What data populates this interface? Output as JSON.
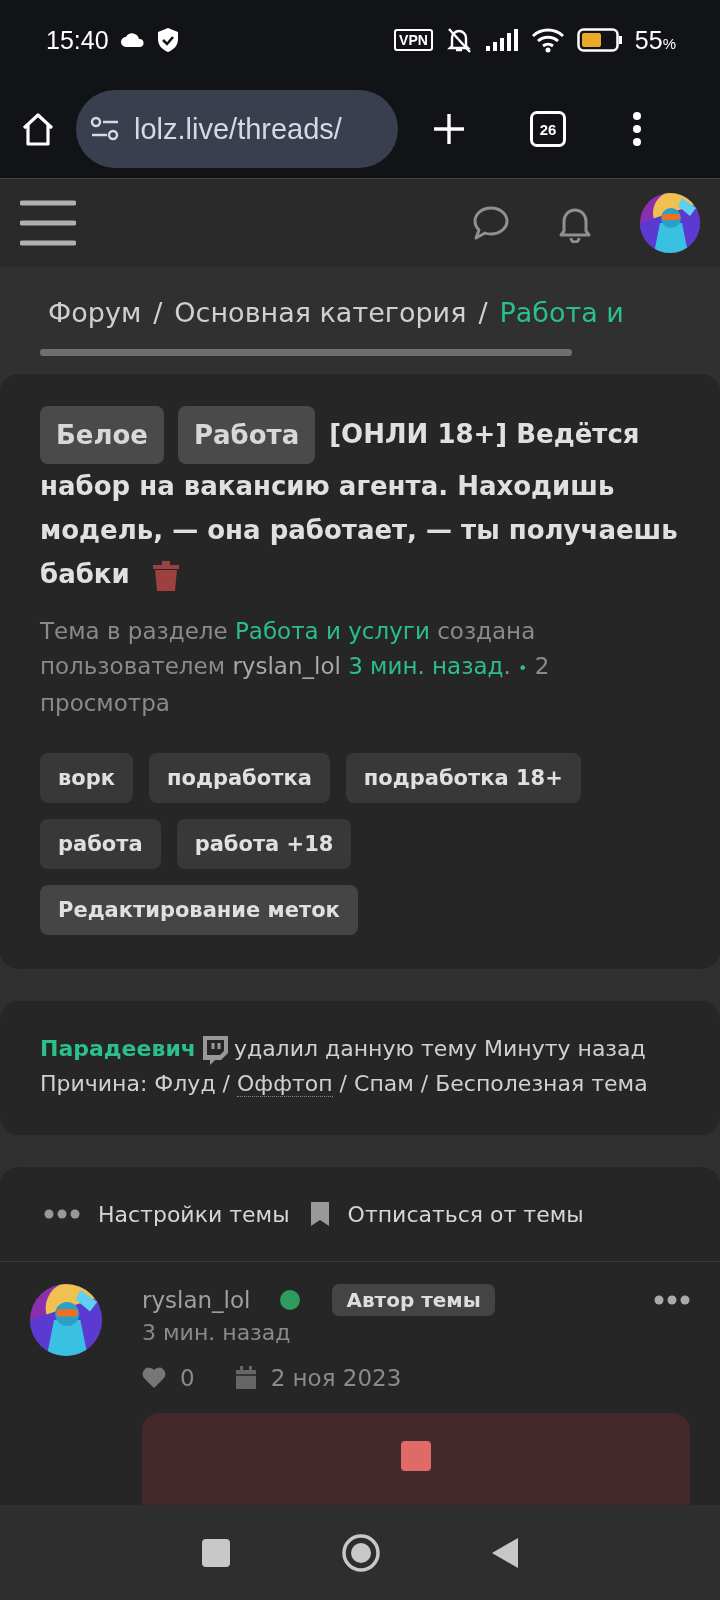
{
  "status_bar": {
    "time": "15:40",
    "vpn": "VPN",
    "battery_percent": "55",
    "percent_sign": "%"
  },
  "browser": {
    "url": "lolz.live/threads/",
    "tab_count": "26"
  },
  "breadcrumb_separator": "/",
  "breadcrumbs": [
    {
      "label": "Форум",
      "current": false
    },
    {
      "label": "Основная категория",
      "current": false
    },
    {
      "label": "Работа и",
      "current": true
    }
  ],
  "thread": {
    "prefixes": [
      "Белое",
      "Работа"
    ],
    "title": "[ОНЛИ 18+] Ведётся набор на вакансию агента. Находишь модель, — она работает, — ты получаешь бабки",
    "meta": {
      "before_section": "Тема в разделе",
      "section": "Работа и услуги",
      "before_author": "создана пользователем",
      "author": "ryslan_lol",
      "time": "3 мин. назад",
      "after_time": ".",
      "bullet": "•",
      "views": "2 просмотра"
    },
    "tags": [
      "ворк",
      "подработка",
      "подработка 18+",
      "работа",
      "работа +18"
    ],
    "edit_tags": "Редактирование меток"
  },
  "deletion_notice": {
    "moderator": "Парадеевич",
    "text": "удалил данную тему Минуту назад Причина: Флуд /",
    "reason_link": "Оффтоп",
    "text_after": "/ Спам / Бесполезная тема"
  },
  "thread_actions": [
    {
      "kind": "dots",
      "label": "Настройки темы"
    },
    {
      "kind": "bookmark",
      "label": "Отписаться от темы"
    }
  ],
  "post": {
    "author": "ryslan_lol",
    "online": true,
    "badge": "Автор темы",
    "time": "3 мин. назад",
    "likes": "0",
    "date": "2 ноя 2023"
  }
}
